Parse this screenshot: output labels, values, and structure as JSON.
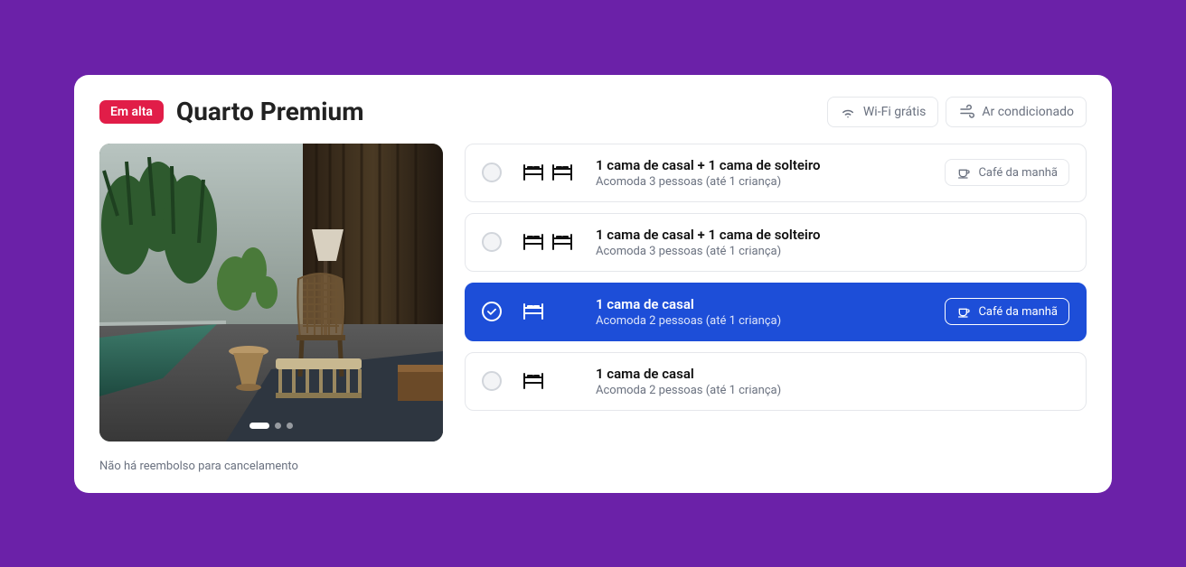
{
  "badge": "Em alta",
  "title": "Quarto Premium",
  "amenities": {
    "wifi": "Wi-Fi grátis",
    "ac": "Ar condicionado"
  },
  "footnote": "Não há reembolso para cancelamento",
  "breakfast_label": "Café da manhã",
  "options": [
    {
      "title": "1 cama de casal + 1 cama de solteiro",
      "sub": "Acomoda 3 pessoas (até 1 criança)",
      "beds": 2,
      "breakfast": true,
      "selected": false
    },
    {
      "title": "1 cama de casal + 1 cama de solteiro",
      "sub": "Acomoda 3 pessoas (até 1 criança)",
      "beds": 2,
      "breakfast": false,
      "selected": false
    },
    {
      "title": "1 cama de casal",
      "sub": "Acomoda 2 pessoas (até 1 criança)",
      "beds": 1,
      "breakfast": true,
      "selected": true
    },
    {
      "title": "1 cama de casal",
      "sub": "Acomoda 2 pessoas (até 1 criança)",
      "beds": 1,
      "breakfast": false,
      "selected": false
    }
  ]
}
